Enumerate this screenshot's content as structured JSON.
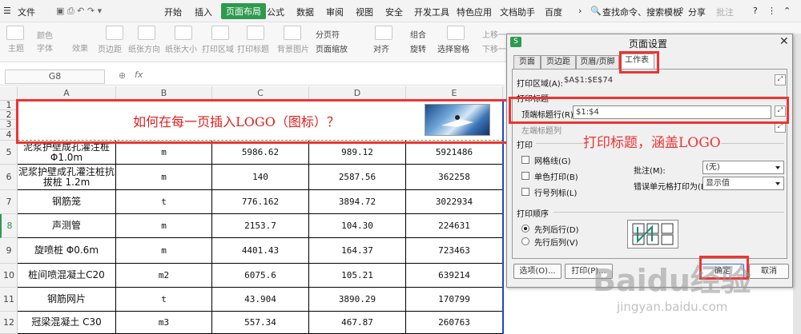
{
  "menubar": {
    "file_label": "文件",
    "items": [
      "开始",
      "插入",
      "页面布局",
      "公式",
      "数据",
      "审阅",
      "视图",
      "安全",
      "开发工具",
      "特色应用",
      "文档助手",
      "百度"
    ],
    "search_label": "查找命令、搜索模板",
    "share_label": "分享",
    "comment_label": "批注"
  },
  "ribbon": {
    "labels": [
      "主题",
      "颜色",
      "字体",
      "效果",
      "页边距",
      "纸张方向",
      "纸张大小",
      "打印区域",
      "打印标题",
      "背景图片",
      "分页符",
      "页面缩放",
      "对齐",
      "组合",
      "旋转",
      "选择窗格",
      "上移一",
      "下移一"
    ]
  },
  "formula_bar": {
    "cell_ref": "G8",
    "fx_label": "fx"
  },
  "sheet": {
    "columns": [
      "A",
      "B",
      "C",
      "D",
      "E"
    ],
    "header_row_numbers": [
      "1",
      "2",
      "3",
      "4"
    ],
    "title": "如何在每一页插入LOGO（图标）？",
    "rows": [
      {
        "num": "5",
        "a": "泥浆护壁成孔灌注桩 Φ1.0m",
        "b": "m",
        "c": "5986.62",
        "d": "989.12",
        "e": "5921486"
      },
      {
        "num": "6",
        "a": "泥浆护壁成孔灌注桩抗拔桩 1.2m",
        "b": "m",
        "c": "140",
        "d": "2587.56",
        "e": "362258"
      },
      {
        "num": "7",
        "a": "钢筋笼",
        "b": "t",
        "c": "776.162",
        "d": "3894.72",
        "e": "3022934"
      },
      {
        "num": "8",
        "a": "声测管",
        "b": "m",
        "c": "2153.7",
        "d": "104.30",
        "e": "224631"
      },
      {
        "num": "9",
        "a": "旋喷桩 Φ0.6m",
        "b": "m",
        "c": "4401.43",
        "d": "164.37",
        "e": "723463"
      },
      {
        "num": "10",
        "a": "桩间喷混凝土C20",
        "b": "m2",
        "c": "6075.6",
        "d": "105.21",
        "e": "639214"
      },
      {
        "num": "11",
        "a": "钢筋网片",
        "b": "t",
        "c": "43.904",
        "d": "3890.29",
        "e": "170799"
      },
      {
        "num": "12",
        "a": "冠梁混凝土 C30",
        "b": "m3",
        "c": "557.34",
        "d": "467.87",
        "e": "260763"
      }
    ]
  },
  "dialog": {
    "title": "页面设置",
    "tabs": [
      "页面",
      "页边距",
      "页眉/页脚",
      "工作表"
    ],
    "print_area_label": "打印区域(A):",
    "print_area_value": "$A$1:$E$74",
    "print_titles_section": "打印标题",
    "top_rows_label": "顶端标题行(R):",
    "top_rows_value": "$1:$4",
    "left_cols_label": "左端标题列",
    "print_section": "打印",
    "gridlines_label": "网格线(G)",
    "mono_label": "单色打印(B)",
    "rowcol_label": "行号列标(L)",
    "comments_label": "批注(M):",
    "comments_value": "(无)",
    "errors_label": "错误单元格打印为(E):",
    "errors_value": "显示值",
    "order_section": "打印顺序",
    "order_down_label": "先列后行(D)",
    "order_over_label": "先行后列(V)",
    "options_button": "选项(O)...",
    "print_button": "打印(P)...",
    "ok_button": "确定",
    "cancel_button": "取消"
  },
  "annotations": {
    "print_title_note": "打印标题，涵盖LOGO"
  },
  "watermark": {
    "brand": "Baidu经验",
    "url": "jingyan.baidu.com"
  }
}
